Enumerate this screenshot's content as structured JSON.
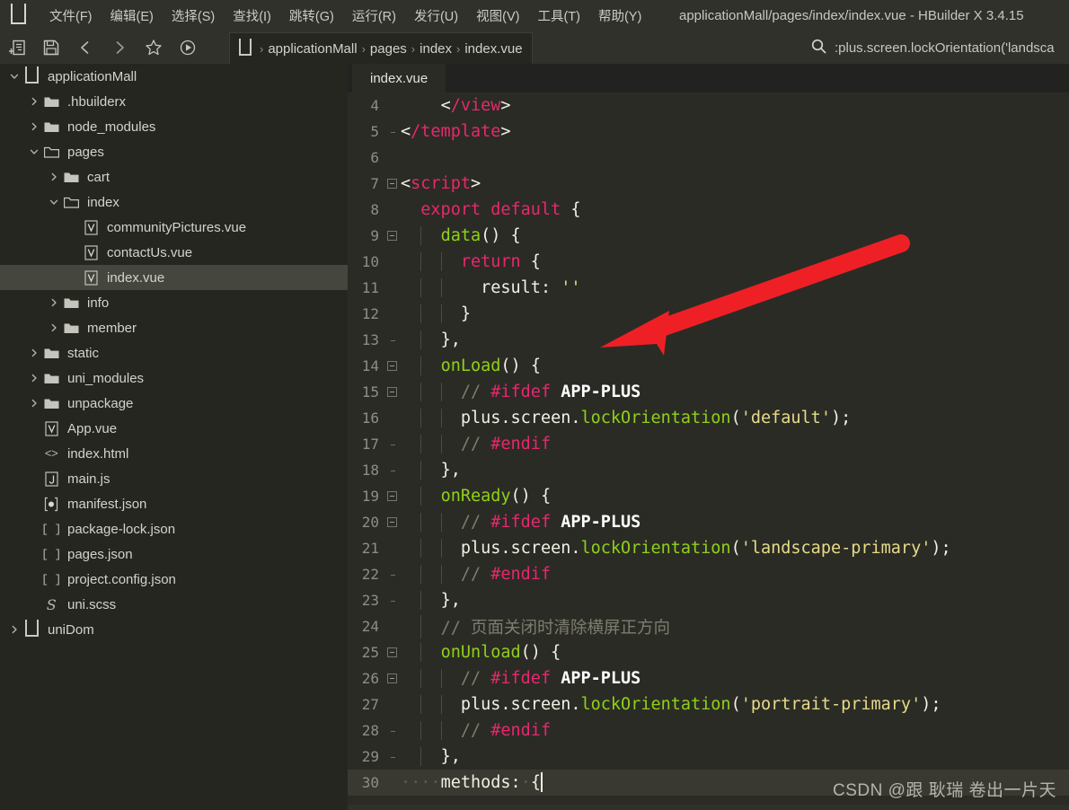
{
  "window": {
    "title": "applicationMall/pages/index/index.vue - HBuilder X 3.4.15",
    "logo_icon": "hbuilder-logo-icon"
  },
  "menubar": {
    "items": [
      {
        "label": "文件(F)"
      },
      {
        "label": "编辑(E)"
      },
      {
        "label": "选择(S)"
      },
      {
        "label": "查找(I)"
      },
      {
        "label": "跳转(G)"
      },
      {
        "label": "运行(R)"
      },
      {
        "label": "发行(U)"
      },
      {
        "label": "视图(V)"
      },
      {
        "label": "工具(T)"
      },
      {
        "label": "帮助(Y)"
      }
    ]
  },
  "toolbar": {
    "buttons": [
      {
        "icon": "new-file-icon"
      },
      {
        "icon": "save-icon"
      },
      {
        "icon": "back-icon"
      },
      {
        "icon": "forward-icon"
      },
      {
        "icon": "favorite-star-icon"
      },
      {
        "icon": "run-icon"
      }
    ],
    "breadcrumb": {
      "project_icon": "hbuilder-project-icon",
      "separator": "›",
      "items": [
        "applicationMall",
        "pages",
        "index",
        "index.vue"
      ]
    },
    "search": {
      "icon": "search-icon",
      "value": ":plus.screen.lockOrientation('landsca"
    }
  },
  "sidebar": {
    "tree": [
      {
        "label": "applicationMall",
        "depth": 0,
        "chevron": "down",
        "icon": "hbuilder-project-icon",
        "selected": false
      },
      {
        "label": ".hbuilderx",
        "depth": 1,
        "chevron": "right",
        "icon": "folder-icon",
        "selected": false
      },
      {
        "label": "node_modules",
        "depth": 1,
        "chevron": "right",
        "icon": "folder-icon",
        "selected": false
      },
      {
        "label": "pages",
        "depth": 1,
        "chevron": "down",
        "icon": "folder-open-icon",
        "selected": false
      },
      {
        "label": "cart",
        "depth": 2,
        "chevron": "right",
        "icon": "folder-icon",
        "selected": false
      },
      {
        "label": "index",
        "depth": 2,
        "chevron": "down",
        "icon": "folder-open-icon",
        "selected": false
      },
      {
        "label": "communityPictures.vue",
        "depth": 3,
        "chevron": "none",
        "icon": "vue-file-icon",
        "selected": false
      },
      {
        "label": "contactUs.vue",
        "depth": 3,
        "chevron": "none",
        "icon": "vue-file-icon",
        "selected": false
      },
      {
        "label": "index.vue",
        "depth": 3,
        "chevron": "none",
        "icon": "vue-file-icon",
        "selected": true
      },
      {
        "label": "info",
        "depth": 2,
        "chevron": "right",
        "icon": "folder-icon",
        "selected": false
      },
      {
        "label": "member",
        "depth": 2,
        "chevron": "right",
        "icon": "folder-icon",
        "selected": false
      },
      {
        "label": "static",
        "depth": 1,
        "chevron": "right",
        "icon": "folder-icon",
        "selected": false
      },
      {
        "label": "uni_modules",
        "depth": 1,
        "chevron": "right",
        "icon": "folder-icon",
        "selected": false
      },
      {
        "label": "unpackage",
        "depth": 1,
        "chevron": "right",
        "icon": "folder-icon",
        "selected": false
      },
      {
        "label": "App.vue",
        "depth": 1,
        "chevron": "none",
        "icon": "vue-file-icon",
        "selected": false
      },
      {
        "label": "index.html",
        "depth": 1,
        "chevron": "none",
        "icon": "html-file-icon",
        "selected": false
      },
      {
        "label": "main.js",
        "depth": 1,
        "chevron": "none",
        "icon": "js-file-icon",
        "selected": false
      },
      {
        "label": "manifest.json",
        "depth": 1,
        "chevron": "none",
        "icon": "manifest-json-icon",
        "selected": false
      },
      {
        "label": "package-lock.json",
        "depth": 1,
        "chevron": "none",
        "icon": "json-file-icon",
        "selected": false
      },
      {
        "label": "pages.json",
        "depth": 1,
        "chevron": "none",
        "icon": "json-file-icon",
        "selected": false
      },
      {
        "label": "project.config.json",
        "depth": 1,
        "chevron": "none",
        "icon": "json-file-icon",
        "selected": false
      },
      {
        "label": "uni.scss",
        "depth": 1,
        "chevron": "none",
        "icon": "scss-file-icon",
        "selected": false
      },
      {
        "label": "uniDom",
        "depth": 0,
        "chevron": "right",
        "icon": "hbuilder-project-icon",
        "selected": false
      }
    ]
  },
  "editor": {
    "tab": {
      "label": "index.vue"
    },
    "lines": [
      {
        "num": "4",
        "fold": "bar",
        "indent_guides": 0,
        "active": false,
        "tokens": [
          {
            "t": "plain",
            "v": "    "
          },
          {
            "t": "punc",
            "v": "<"
          },
          {
            "t": "tag",
            "v": "/view"
          },
          {
            "t": "punc",
            "v": ">"
          }
        ]
      },
      {
        "num": "5",
        "fold": "end",
        "indent_guides": 0,
        "active": false,
        "tokens": [
          {
            "t": "punc",
            "v": "<"
          },
          {
            "t": "tag",
            "v": "/template"
          },
          {
            "t": "punc",
            "v": ">"
          }
        ]
      },
      {
        "num": "6",
        "fold": "none",
        "indent_guides": 0,
        "active": false,
        "tokens": []
      },
      {
        "num": "7",
        "fold": "box",
        "indent_guides": 0,
        "active": false,
        "tokens": [
          {
            "t": "punc",
            "v": "<"
          },
          {
            "t": "tag",
            "v": "script"
          },
          {
            "t": "punc",
            "v": ">"
          }
        ]
      },
      {
        "num": "8",
        "fold": "bar",
        "indent_guides": 0,
        "active": false,
        "tokens": [
          {
            "t": "plain",
            "v": "  "
          },
          {
            "t": "kw",
            "v": "export default"
          },
          {
            "t": "plain",
            "v": " "
          },
          {
            "t": "punc",
            "v": "{"
          }
        ]
      },
      {
        "num": "9",
        "fold": "box",
        "indent_guides": 1,
        "active": false,
        "tokens": [
          {
            "t": "plain",
            "v": "    "
          },
          {
            "t": "fn",
            "v": "data"
          },
          {
            "t": "punc",
            "v": "()"
          },
          {
            "t": "plain",
            "v": " "
          },
          {
            "t": "punc",
            "v": "{"
          }
        ]
      },
      {
        "num": "10",
        "fold": "bar",
        "indent_guides": 2,
        "active": false,
        "tokens": [
          {
            "t": "plain",
            "v": "      "
          },
          {
            "t": "kw",
            "v": "return"
          },
          {
            "t": "plain",
            "v": " "
          },
          {
            "t": "punc",
            "v": "{"
          }
        ]
      },
      {
        "num": "11",
        "fold": "bar",
        "indent_guides": 2,
        "active": false,
        "tokens": [
          {
            "t": "plain",
            "v": "        "
          },
          {
            "t": "prop",
            "v": "result"
          },
          {
            "t": "punc",
            "v": ":"
          },
          {
            "t": "plain",
            "v": " "
          },
          {
            "t": "str",
            "v": "''"
          }
        ]
      },
      {
        "num": "12",
        "fold": "bar",
        "indent_guides": 2,
        "active": false,
        "tokens": [
          {
            "t": "plain",
            "v": "      "
          },
          {
            "t": "punc",
            "v": "}"
          }
        ]
      },
      {
        "num": "13",
        "fold": "end",
        "indent_guides": 1,
        "active": false,
        "tokens": [
          {
            "t": "plain",
            "v": "    "
          },
          {
            "t": "punc",
            "v": "},"
          }
        ]
      },
      {
        "num": "14",
        "fold": "box",
        "indent_guides": 1,
        "active": false,
        "tokens": [
          {
            "t": "plain",
            "v": "    "
          },
          {
            "t": "fn",
            "v": "onLoad"
          },
          {
            "t": "punc",
            "v": "()"
          },
          {
            "t": "plain",
            "v": " "
          },
          {
            "t": "punc",
            "v": "{"
          }
        ]
      },
      {
        "num": "15",
        "fold": "box",
        "indent_guides": 2,
        "active": false,
        "tokens": [
          {
            "t": "plain",
            "v": "      "
          },
          {
            "t": "cmt",
            "v": "// "
          },
          {
            "t": "pre",
            "v": "#ifdef"
          },
          {
            "t": "plain",
            "v": " "
          },
          {
            "t": "prew",
            "v": "APP-PLUS"
          }
        ]
      },
      {
        "num": "16",
        "fold": "bar",
        "indent_guides": 2,
        "active": false,
        "tokens": [
          {
            "t": "plain",
            "v": "      "
          },
          {
            "t": "plain",
            "v": "plus"
          },
          {
            "t": "dot",
            "v": "."
          },
          {
            "t": "plain",
            "v": "screen"
          },
          {
            "t": "dot",
            "v": "."
          },
          {
            "t": "fn",
            "v": "lockOrientation"
          },
          {
            "t": "punc",
            "v": "("
          },
          {
            "t": "str",
            "v": "'default'"
          },
          {
            "t": "punc",
            "v": ");"
          }
        ]
      },
      {
        "num": "17",
        "fold": "end",
        "indent_guides": 2,
        "active": false,
        "tokens": [
          {
            "t": "plain",
            "v": "      "
          },
          {
            "t": "cmt",
            "v": "// "
          },
          {
            "t": "pre",
            "v": "#endif"
          }
        ]
      },
      {
        "num": "18",
        "fold": "end",
        "indent_guides": 1,
        "active": false,
        "tokens": [
          {
            "t": "plain",
            "v": "    "
          },
          {
            "t": "punc",
            "v": "},"
          }
        ]
      },
      {
        "num": "19",
        "fold": "box",
        "indent_guides": 1,
        "active": false,
        "tokens": [
          {
            "t": "plain",
            "v": "    "
          },
          {
            "t": "fn",
            "v": "onReady"
          },
          {
            "t": "punc",
            "v": "()"
          },
          {
            "t": "plain",
            "v": " "
          },
          {
            "t": "punc",
            "v": "{"
          }
        ]
      },
      {
        "num": "20",
        "fold": "box",
        "indent_guides": 2,
        "active": false,
        "tokens": [
          {
            "t": "plain",
            "v": "      "
          },
          {
            "t": "cmt",
            "v": "// "
          },
          {
            "t": "pre",
            "v": "#ifdef"
          },
          {
            "t": "plain",
            "v": " "
          },
          {
            "t": "prew",
            "v": "APP-PLUS"
          }
        ]
      },
      {
        "num": "21",
        "fold": "bar",
        "indent_guides": 2,
        "active": false,
        "tokens": [
          {
            "t": "plain",
            "v": "      "
          },
          {
            "t": "plain",
            "v": "plus"
          },
          {
            "t": "dot",
            "v": "."
          },
          {
            "t": "plain",
            "v": "screen"
          },
          {
            "t": "dot",
            "v": "."
          },
          {
            "t": "fn",
            "v": "lockOrientation"
          },
          {
            "t": "punc",
            "v": "("
          },
          {
            "t": "str",
            "v": "'landscape-primary'"
          },
          {
            "t": "punc",
            "v": ");"
          }
        ]
      },
      {
        "num": "22",
        "fold": "end",
        "indent_guides": 2,
        "active": false,
        "tokens": [
          {
            "t": "plain",
            "v": "      "
          },
          {
            "t": "cmt",
            "v": "// "
          },
          {
            "t": "pre",
            "v": "#endif"
          }
        ]
      },
      {
        "num": "23",
        "fold": "end",
        "indent_guides": 1,
        "active": false,
        "tokens": [
          {
            "t": "plain",
            "v": "    "
          },
          {
            "t": "punc",
            "v": "},"
          }
        ]
      },
      {
        "num": "24",
        "fold": "bar",
        "indent_guides": 1,
        "active": false,
        "tokens": [
          {
            "t": "plain",
            "v": "    "
          },
          {
            "t": "cmt",
            "v": "// 页面关闭时清除横屏正方向"
          }
        ]
      },
      {
        "num": "25",
        "fold": "box",
        "indent_guides": 1,
        "active": false,
        "tokens": [
          {
            "t": "plain",
            "v": "    "
          },
          {
            "t": "fn",
            "v": "onUnload"
          },
          {
            "t": "punc",
            "v": "()"
          },
          {
            "t": "plain",
            "v": " "
          },
          {
            "t": "punc",
            "v": "{"
          }
        ]
      },
      {
        "num": "26",
        "fold": "box",
        "indent_guides": 2,
        "active": false,
        "tokens": [
          {
            "t": "plain",
            "v": "      "
          },
          {
            "t": "cmt",
            "v": "// "
          },
          {
            "t": "pre",
            "v": "#ifdef"
          },
          {
            "t": "plain",
            "v": " "
          },
          {
            "t": "prew",
            "v": "APP-PLUS"
          }
        ]
      },
      {
        "num": "27",
        "fold": "bar",
        "indent_guides": 2,
        "active": false,
        "tokens": [
          {
            "t": "plain",
            "v": "      "
          },
          {
            "t": "plain",
            "v": "plus"
          },
          {
            "t": "dot",
            "v": "."
          },
          {
            "t": "plain",
            "v": "screen"
          },
          {
            "t": "dot",
            "v": "."
          },
          {
            "t": "fn",
            "v": "lockOrientation"
          },
          {
            "t": "punc",
            "v": "("
          },
          {
            "t": "str",
            "v": "'portrait-primary'"
          },
          {
            "t": "punc",
            "v": ");"
          }
        ]
      },
      {
        "num": "28",
        "fold": "end",
        "indent_guides": 2,
        "active": false,
        "tokens": [
          {
            "t": "plain",
            "v": "      "
          },
          {
            "t": "cmt",
            "v": "// "
          },
          {
            "t": "pre",
            "v": "#endif"
          }
        ]
      },
      {
        "num": "29",
        "fold": "end",
        "indent_guides": 1,
        "active": false,
        "tokens": [
          {
            "t": "plain",
            "v": "    "
          },
          {
            "t": "punc",
            "v": "},"
          }
        ]
      },
      {
        "num": "30",
        "fold": "none",
        "indent_guides": 0,
        "active": true,
        "tokens": [
          {
            "t": "ws",
            "v": "····"
          },
          {
            "t": "prop",
            "v": "methods"
          },
          {
            "t": "punc",
            "v": ":"
          },
          {
            "t": "ws",
            "v": "·"
          },
          {
            "t": "punc",
            "v": "{"
          },
          {
            "t": "cursor",
            "v": ""
          }
        ]
      }
    ]
  },
  "annotation": {
    "arrow_color": "#ee2025",
    "arrow_name": "red-annotation-arrow"
  },
  "watermark": {
    "text": "CSDN @跟 耿瑞 卷出一片天"
  },
  "colors": {
    "editor_bg": "#2b2b26",
    "sidebar_bg": "#262620",
    "chrome_bg": "#31312b",
    "selection_bg": "#45463d",
    "accent_pink": "#e6286e",
    "accent_green": "#8fd119",
    "accent_string": "#e7db89"
  }
}
